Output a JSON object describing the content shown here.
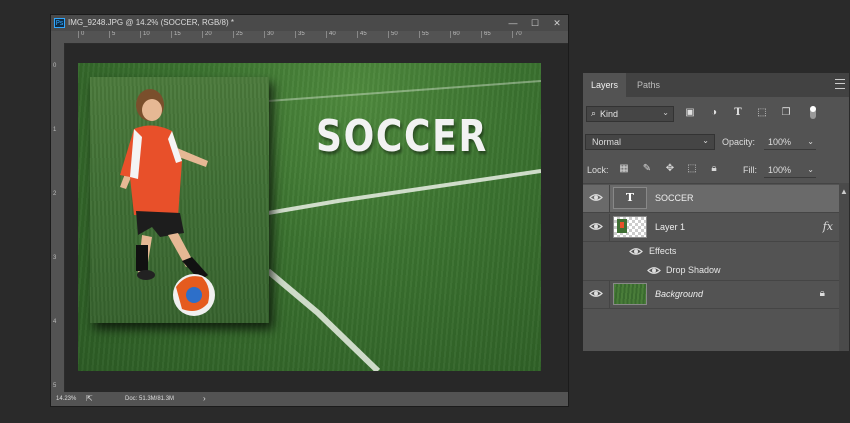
{
  "document": {
    "title": "IMG_9248.JPG @ 14.2% (SOCCER, RGB/8) *",
    "app_badge": "Ps",
    "window_buttons": {
      "minimize": "—",
      "maximize": "☐",
      "close": "✕"
    },
    "ruler_top_labels": [
      "0",
      "5",
      "10",
      "15",
      "20",
      "25",
      "30",
      "35",
      "40",
      "45",
      "50",
      "55",
      "60",
      "65",
      "70"
    ],
    "ruler_left_labels": [
      "0",
      "1",
      "2",
      "3",
      "4",
      "5"
    ],
    "status": {
      "zoom": "14.23%",
      "doc_info": "Doc: 51.3M/81.3M",
      "arrow": "›"
    },
    "canvas_text": "SOCCER"
  },
  "layers_panel": {
    "tabs": [
      "Layers",
      "Paths"
    ],
    "filter": {
      "label": "Kind",
      "icons": [
        "image-filter-icon",
        "adjustment-filter-icon",
        "type-filter-icon",
        "shape-filter-icon",
        "smart-object-filter-icon"
      ]
    },
    "blend_mode": "Normal",
    "opacity_label": "Opacity:",
    "opacity_value": "100%",
    "lock_label": "Lock:",
    "fill_label": "Fill:",
    "fill_value": "100%",
    "layers": [
      {
        "name": "SOCCER",
        "type": "text",
        "selected": true
      },
      {
        "name": "Layer 1",
        "type": "pixel",
        "fx": "fx",
        "effects_label": "Effects",
        "effects": [
          "Drop Shadow"
        ]
      },
      {
        "name": "Background",
        "type": "background",
        "locked": true
      }
    ]
  },
  "colors": {
    "accent": "#31a8ff",
    "panel": "#535353",
    "selected_layer": "#6a6a6a",
    "app_bg": "#2a2a2a"
  }
}
